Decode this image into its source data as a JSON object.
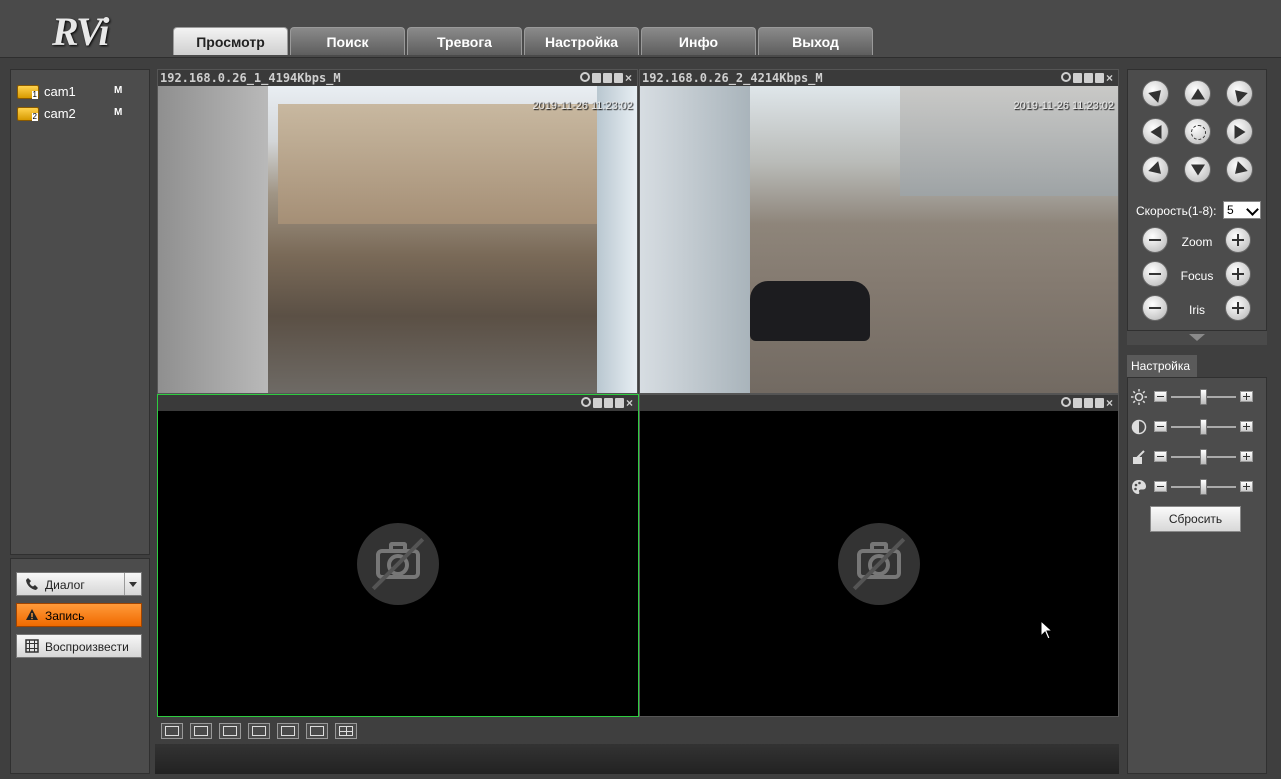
{
  "header": {
    "logo": "RVi",
    "tabs": [
      {
        "label": "Просмотр",
        "active": true
      },
      {
        "label": "Поиск",
        "active": false
      },
      {
        "label": "Тревога",
        "active": false
      },
      {
        "label": "Настройка",
        "active": false
      },
      {
        "label": "Инфо",
        "active": false
      },
      {
        "label": "Выход",
        "active": false
      }
    ]
  },
  "cameras": [
    {
      "name": "cam1",
      "index": "1",
      "stream": "M"
    },
    {
      "name": "cam2",
      "index": "2",
      "stream": "M"
    }
  ],
  "left_actions": {
    "dialog": "Диалог",
    "record": "Запись",
    "playback": "Воспроизвести"
  },
  "videos": [
    {
      "title": "192.168.0.26_1_4194Kbps_M",
      "timestamp": "2019-11-26 11:23:02",
      "active": false
    },
    {
      "title": "192.168.0.26_2_4214Kbps_M",
      "timestamp": "2019-11-26 11:23:02",
      "active": false
    },
    {
      "title": "",
      "timestamp": "",
      "active": true
    },
    {
      "title": "",
      "timestamp": "",
      "active": false
    }
  ],
  "ptz": {
    "speed_label": "Скорость(1-8):",
    "speed_value": "5",
    "zoom": "Zoom",
    "focus": "Focus",
    "iris": "Iris"
  },
  "settings": {
    "tab_label": "Настройка",
    "sliders": [
      {
        "name": "brightness",
        "icon": "sun-icon",
        "level": 0.5
      },
      {
        "name": "contrast",
        "icon": "contrast-icon",
        "level": 0.5
      },
      {
        "name": "saturation",
        "icon": "dropper-icon",
        "level": 0.5
      },
      {
        "name": "hue",
        "icon": "palette-icon",
        "level": 0.5
      }
    ],
    "reset": "Сбросить"
  },
  "colors": {
    "active_cell_border": "#2ecc40",
    "record_button": "#f07a10"
  }
}
